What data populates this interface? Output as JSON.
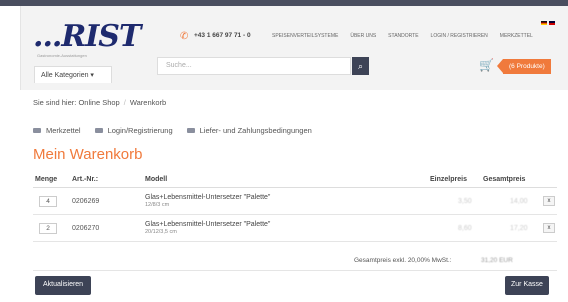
{
  "brand": {
    "logo": "...RIST",
    "tagline": "Gastronomie-Ausstattungen"
  },
  "header": {
    "phone": "+43 1 667 97 71 - 0",
    "nav": [
      "SPEISENVERTEILSYSTEME",
      "ÜBER UNS",
      "STANDORTE",
      "LOGIN / REGISTRIEREN",
      "MERKZETTEL"
    ],
    "category_button": "Alle Kategorien ▾",
    "search_placeholder": "Suche...",
    "cart_badge": "(6 Produkte)"
  },
  "breadcrumb": {
    "prefix": "Sie sind hier: Online Shop",
    "separator": "/",
    "current": "Warenkorb"
  },
  "links": [
    "Merkzettel",
    "Login/Registrierung",
    "Liefer- und Zahlungsbedingungen"
  ],
  "page_title": "Mein Warenkorb",
  "table": {
    "headers": {
      "qty": "Menge",
      "art": "Art.-Nr.:",
      "model": "Modell",
      "unit": "Einzelpreis",
      "total": "Gesamtpreis"
    },
    "rows": [
      {
        "qty": "4",
        "art": "0206269",
        "model": "Glas+Lebensmittel-Untersetzer \"Palette\"",
        "size": "12/8/3 cm",
        "unit": "3,50",
        "total": "14,00",
        "remove": "x"
      },
      {
        "qty": "2",
        "art": "0206270",
        "model": "Glas+Lebensmittel-Untersetzer \"Palette\"",
        "size": "20/12/3,5 cm",
        "unit": "8,60",
        "total": "17,20",
        "remove": "x"
      }
    ]
  },
  "summary": {
    "label": "Gesamtpreis exkl. 20,00% MwSt.:",
    "value": "31,20 EUR"
  },
  "buttons": {
    "update": "Aktualisieren",
    "checkout": "Zur Kasse"
  },
  "colors": {
    "accent": "#f07a3c",
    "dark": "#3d4356",
    "brand": "#1e2a6e"
  }
}
